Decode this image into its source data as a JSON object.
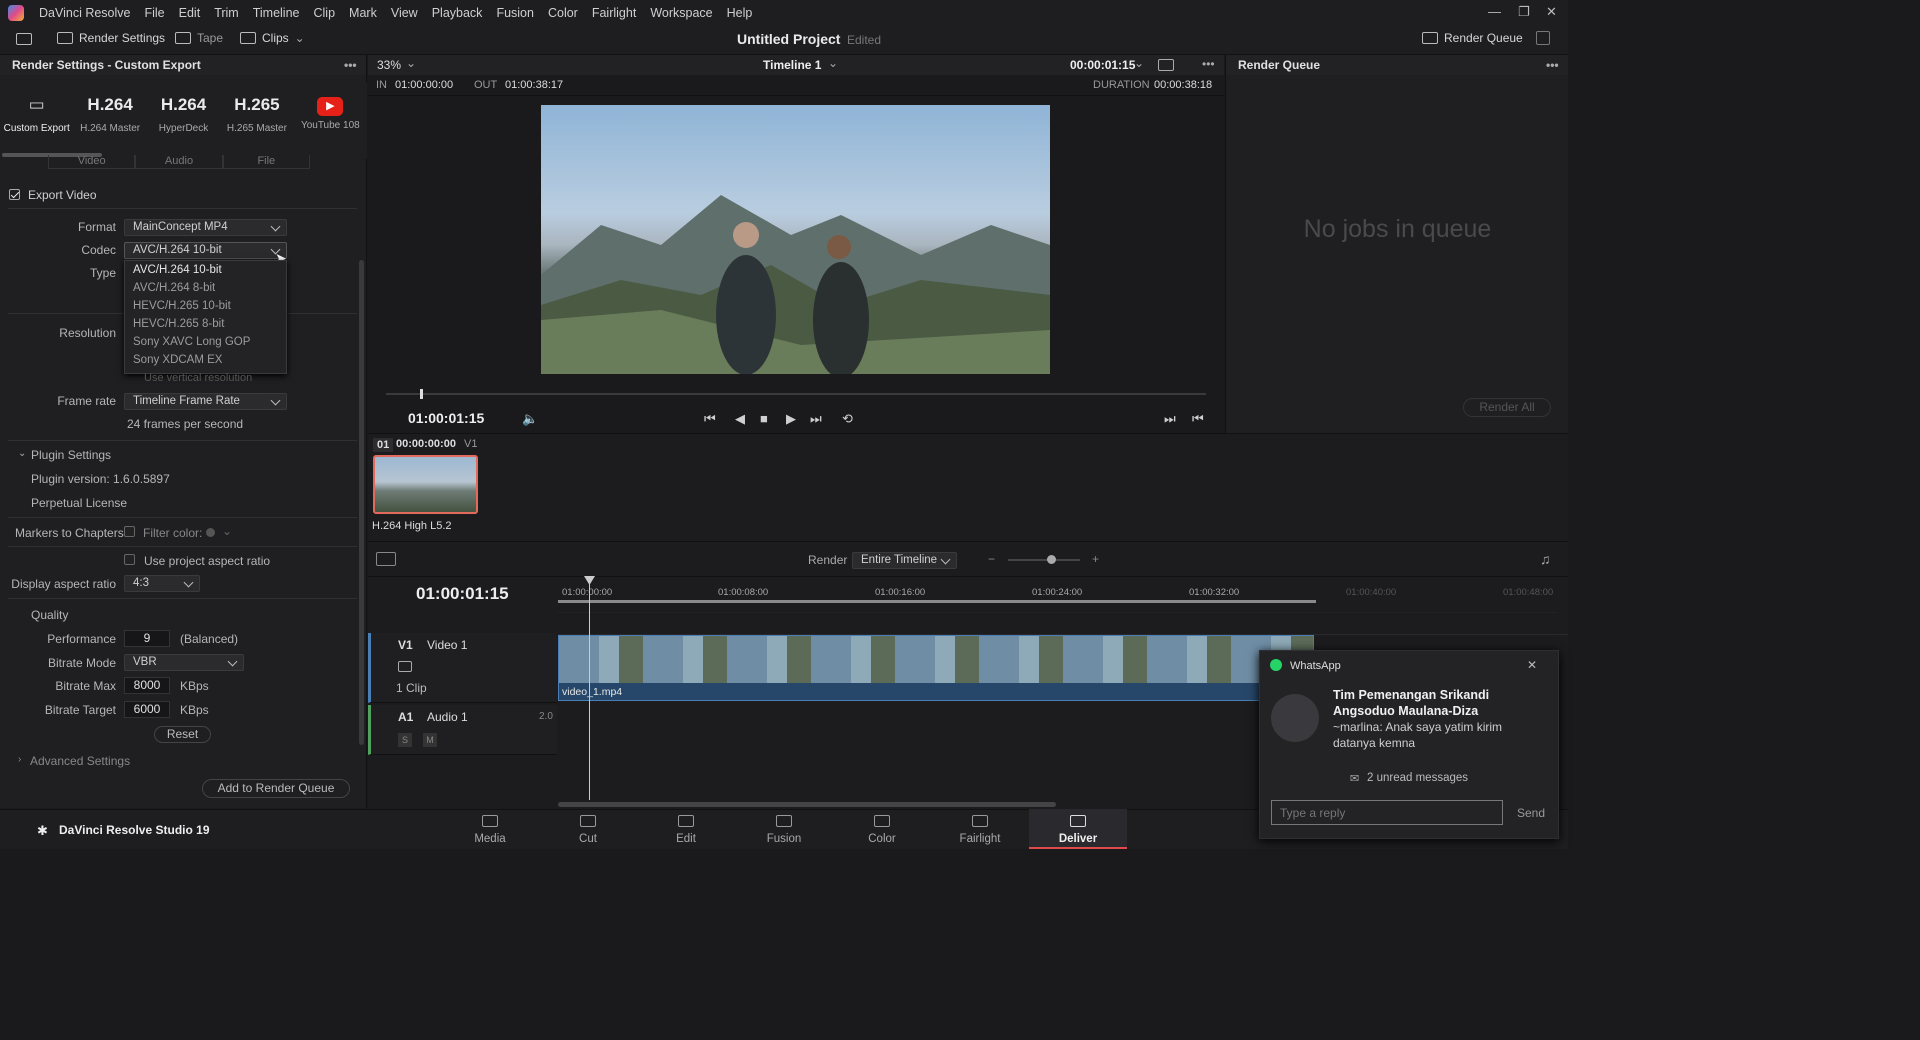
{
  "menubar": {
    "app": "DaVinci Resolve",
    "items": [
      "File",
      "Edit",
      "Trim",
      "Timeline",
      "Clip",
      "Mark",
      "View",
      "Playback",
      "Fusion",
      "Color",
      "Fairlight",
      "Workspace",
      "Help"
    ]
  },
  "toolbar": {
    "render_settings": "Render Settings",
    "tape": "Tape",
    "clips": "Clips",
    "project": "Untitled Project",
    "edited": "Edited",
    "render_queue": "Render Queue"
  },
  "left": {
    "title": "Render Settings - Custom Export",
    "presets": [
      {
        "big": "▭",
        "label": "Custom Export"
      },
      {
        "big": "H.264",
        "label": "H.264 Master"
      },
      {
        "big": "H.264",
        "label": "HyperDeck"
      },
      {
        "big": "H.265",
        "label": "H.265 Master"
      },
      {
        "big": "▶",
        "label": "YouTube 108"
      }
    ],
    "tabs": [
      "Video",
      "Audio",
      "File"
    ],
    "export_video": "Export Video",
    "format_label": "Format",
    "format_value": "MainConcept MP4",
    "codec_label": "Codec",
    "codec_value": "AVC/H.264 10-bit",
    "type_label": "Type",
    "resolution_label": "Resolution",
    "codec_options": [
      "AVC/H.264 10-bit",
      "AVC/H.264 8-bit",
      "HEVC/H.265 10-bit",
      "HEVC/H.265 8-bit",
      "Sony XAVC Long GOP",
      "Sony XDCAM EX"
    ],
    "use_vertical": "Use vertical resolution",
    "framerate_label": "Frame rate",
    "framerate_value": "Timeline Frame Rate",
    "fps_text": "24 frames per second",
    "plugin_settings": "Plugin Settings",
    "plugin_version": "Plugin version: 1.6.0.5897",
    "perpetual": "Perpetual License",
    "markers_label": "Markers to Chapters",
    "filter_color": "Filter color:",
    "use_project_aspect": "Use project aspect ratio",
    "dar_label": "Display aspect ratio",
    "dar_value": "4:3",
    "quality": "Quality",
    "performance_label": "Performance",
    "performance_value": "9",
    "performance_note": "(Balanced)",
    "bitrate_mode_label": "Bitrate Mode",
    "bitrate_mode_value": "VBR",
    "bitrate_max_label": "Bitrate Max",
    "bitrate_max_value": "8000",
    "bitrate_max_unit": "KBps",
    "bitrate_target_label": "Bitrate Target",
    "bitrate_target_value": "6000",
    "bitrate_target_unit": "KBps",
    "reset": "Reset",
    "advanced": "Advanced Settings",
    "add_queue": "Add to Render Queue"
  },
  "viewer": {
    "zoom": "33%",
    "timeline": "Timeline 1",
    "tc": "00:00:01:15",
    "in_label": "IN",
    "in_tc": "01:00:00:00",
    "out_label": "OUT",
    "out_tc": "01:00:38:17",
    "duration_label": "DURATION",
    "duration_tc": "00:00:38:18",
    "playhead_tc": "01:00:01:15"
  },
  "rq": {
    "title": "Render Queue",
    "empty": "No jobs in queue",
    "render_all": "Render All"
  },
  "bin": {
    "num": "01",
    "tc": "00:00:00:00",
    "track": "V1",
    "clip_name": "H.264 High L5.2"
  },
  "timeline": {
    "render_label": "Render",
    "render_value": "Entire Timeline",
    "tc": "01:00:01:15",
    "ruler": [
      "01:00:00:00",
      "01:00:08:00",
      "01:00:16:00",
      "01:00:24:00",
      "01:00:32:00",
      "01:00:40:00",
      "01:00:48:00"
    ],
    "v1": "V1",
    "v1_name": "Video 1",
    "v1_clips": "1 Clip",
    "a1": "A1",
    "a1_name": "Audio 1",
    "a1_ch": "2.0",
    "solo": "S",
    "mute": "M",
    "clip_label": "video_1.mp4"
  },
  "footer": {
    "brand": "DaVinci Resolve Studio 19",
    "pages": [
      "Media",
      "Cut",
      "Edit",
      "Fusion",
      "Color",
      "Fairlight",
      "Deliver"
    ]
  },
  "toast": {
    "app": "WhatsApp",
    "sender": "Tim Pemenangan Srikandi Angsoduo Maulana-Diza",
    "message": "~marlina: Anak saya yatim kirim datanya kemna",
    "unread": "2 unread messages",
    "placeholder": "Type a reply",
    "send": "Send"
  }
}
